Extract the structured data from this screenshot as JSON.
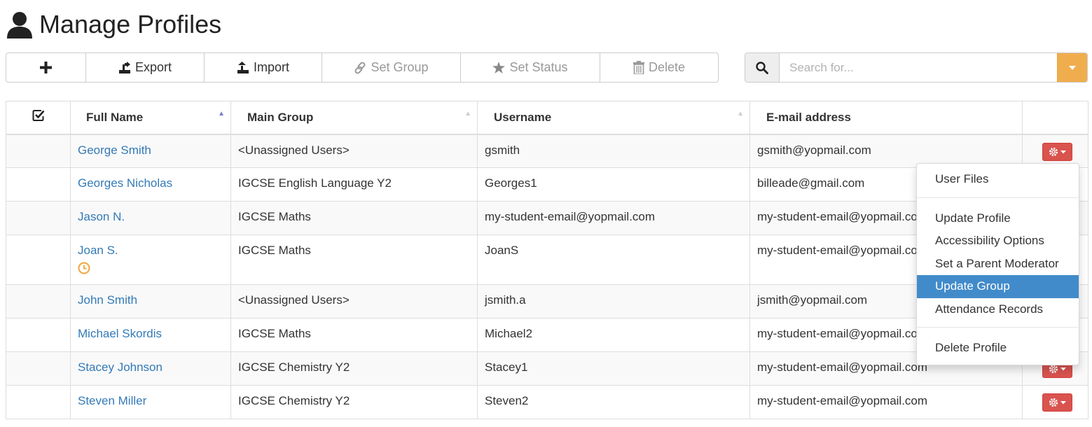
{
  "header": {
    "title": "Manage Profiles"
  },
  "toolbar": {
    "add_label": "",
    "export_label": "Export",
    "import_label": "Import",
    "set_group_label": "Set Group",
    "set_status_label": "Set Status",
    "delete_label": "Delete"
  },
  "search": {
    "placeholder": "Search for...",
    "value": ""
  },
  "table": {
    "columns": [
      "Full Name",
      "Main Group",
      "Username",
      "E-mail address"
    ],
    "rows": [
      {
        "name": "George Smith",
        "group": "<Unassigned Users>",
        "username": "gsmith",
        "email": "gsmith@yopmail.com"
      },
      {
        "name": "Georges Nicholas",
        "group": "IGCSE English Language Y2",
        "username": "Georges1",
        "email": "billeade@gmail.com"
      },
      {
        "name": "Jason N.",
        "group": "IGCSE Maths",
        "username": "my-student-email@yopmail.com",
        "email": "my-student-email@yopmail.com"
      },
      {
        "name": "Joan S.",
        "group": "IGCSE Maths",
        "username": "JoanS",
        "email": "my-student-email@yopmail.com"
      },
      {
        "name": "John Smith",
        "group": "<Unassigned Users>",
        "username": "jsmith.a",
        "email": "jsmith@yopmail.com"
      },
      {
        "name": "Michael Skordis",
        "group": "IGCSE Maths",
        "username": "Michael2",
        "email": "my-student-email@yopmail.com"
      },
      {
        "name": "Stacey Johnson",
        "group": "IGCSE Chemistry Y2",
        "username": "Stacey1",
        "email": "my-student-email@yopmail.com"
      },
      {
        "name": "Steven Miller",
        "group": "IGCSE Chemistry Y2",
        "username": "Steven2",
        "email": "my-student-email@yopmail.com"
      }
    ]
  },
  "menu": {
    "items": [
      "User Files",
      "Update Profile",
      "Accessibility Options",
      "Set a Parent Moderator",
      "Update Group",
      "Attendance Records",
      "Delete Profile"
    ],
    "active": "Update Group"
  },
  "colors": {
    "link": "#337ab7",
    "danger": "#d9534f",
    "warning": "#f0ad4e",
    "menu_active": "#428bca",
    "clock": "#f0ad4e"
  },
  "icons": {
    "header": "user-icon",
    "add": "plus-icon",
    "export": "export-icon",
    "import": "import-icon",
    "set_group": "link-icon",
    "set_status": "star-icon",
    "delete": "trash-icon",
    "search": "search-icon",
    "select_all": "check-square-icon",
    "row_action": "gear-icon",
    "pending": "clock-icon"
  }
}
